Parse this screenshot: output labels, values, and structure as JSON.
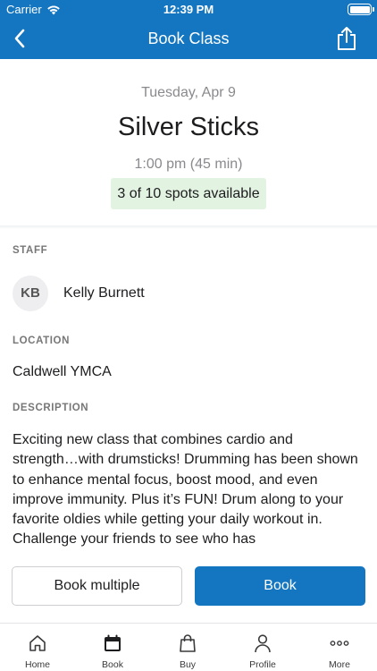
{
  "status_bar": {
    "carrier": "Carrier",
    "time": "12:39 PM"
  },
  "nav": {
    "title": "Book Class",
    "back_icon": "chevron-left-icon",
    "share_icon": "share-icon"
  },
  "class": {
    "date": "Tuesday, Apr 9",
    "name": "Silver Sticks",
    "time": "1:00 pm (45 min)",
    "spots": "3 of 10 spots available",
    "spots_color": "#e3f3e1"
  },
  "staff": {
    "label": "STAFF",
    "initials": "KB",
    "name": "Kelly Burnett"
  },
  "location": {
    "label": "LOCATION",
    "name": "Caldwell YMCA"
  },
  "description": {
    "label": "DESCRIPTION",
    "text": "Exciting new class that combines cardio and strength…with drumsticks! Drumming has been shown to enhance mental focus, boost mood, and even improve immunity. Plus it’s FUN! Drum along to your favorite oldies while getting your daily workout in. Challenge your friends to see who has"
  },
  "actions": {
    "book_multiple": "Book multiple",
    "book": "Book"
  },
  "tabs": [
    {
      "label": "Home",
      "icon": "home-icon",
      "active": false
    },
    {
      "label": "Book",
      "icon": "calendar-icon",
      "active": true
    },
    {
      "label": "Buy",
      "icon": "shopping-bag-icon",
      "active": false
    },
    {
      "label": "Profile",
      "icon": "person-icon",
      "active": false
    },
    {
      "label": "More",
      "icon": "more-dots-icon",
      "active": false
    }
  ],
  "colors": {
    "brand": "#1476c0",
    "background": "#ffffff",
    "secondary_text": "#8a8a8e"
  }
}
